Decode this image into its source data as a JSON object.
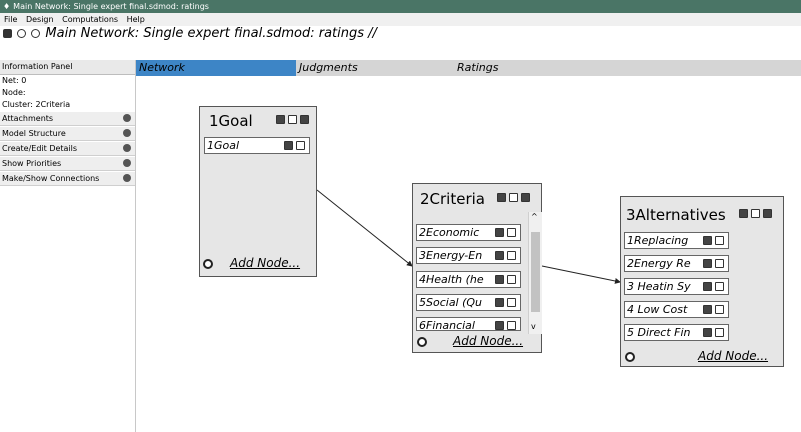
{
  "window": {
    "title": "Main Network: Single expert final.sdmod: ratings"
  },
  "menu": {
    "file": "File",
    "design": "Design",
    "computations": "Computations",
    "help": "Help"
  },
  "path": {
    "text": "Main Network: Single expert final.sdmod: ratings //"
  },
  "sidebar": {
    "header": "Information Panel",
    "net": "Net: 0",
    "node": "Node:",
    "cluster": "Cluster: 2Criteria",
    "items": [
      {
        "label": "Attachments"
      },
      {
        "label": "Model Structure"
      },
      {
        "label": "Create/Edit Details"
      },
      {
        "label": "Show Priorities"
      },
      {
        "label": "Make/Show Connections"
      }
    ]
  },
  "tabs": [
    {
      "label": "Network",
      "active": true
    },
    {
      "label": "Judgments",
      "active": false
    },
    {
      "label": "Ratings",
      "active": false
    }
  ],
  "clusters": {
    "goal": {
      "title": "1Goal",
      "nodes": [
        "1Goal"
      ],
      "add": "Add Node..."
    },
    "criteria": {
      "title": "2Criteria",
      "nodes": [
        "2Economic",
        "3Energy-En",
        "4Health (he",
        "5Social (Qu",
        "6Financial"
      ],
      "add": "Add Node..."
    },
    "alternatives": {
      "title": "3Alternatives",
      "nodes": [
        "1Replacing",
        "2Energy Re",
        "3 Heatin Sy",
        "4 Low Cost",
        "5 Direct Fin"
      ],
      "add": "Add Node..."
    }
  },
  "colors": {
    "titlebar": "#4a7566",
    "active_tab": "#3d85c6",
    "cluster_bg": "#e6e6e6"
  }
}
